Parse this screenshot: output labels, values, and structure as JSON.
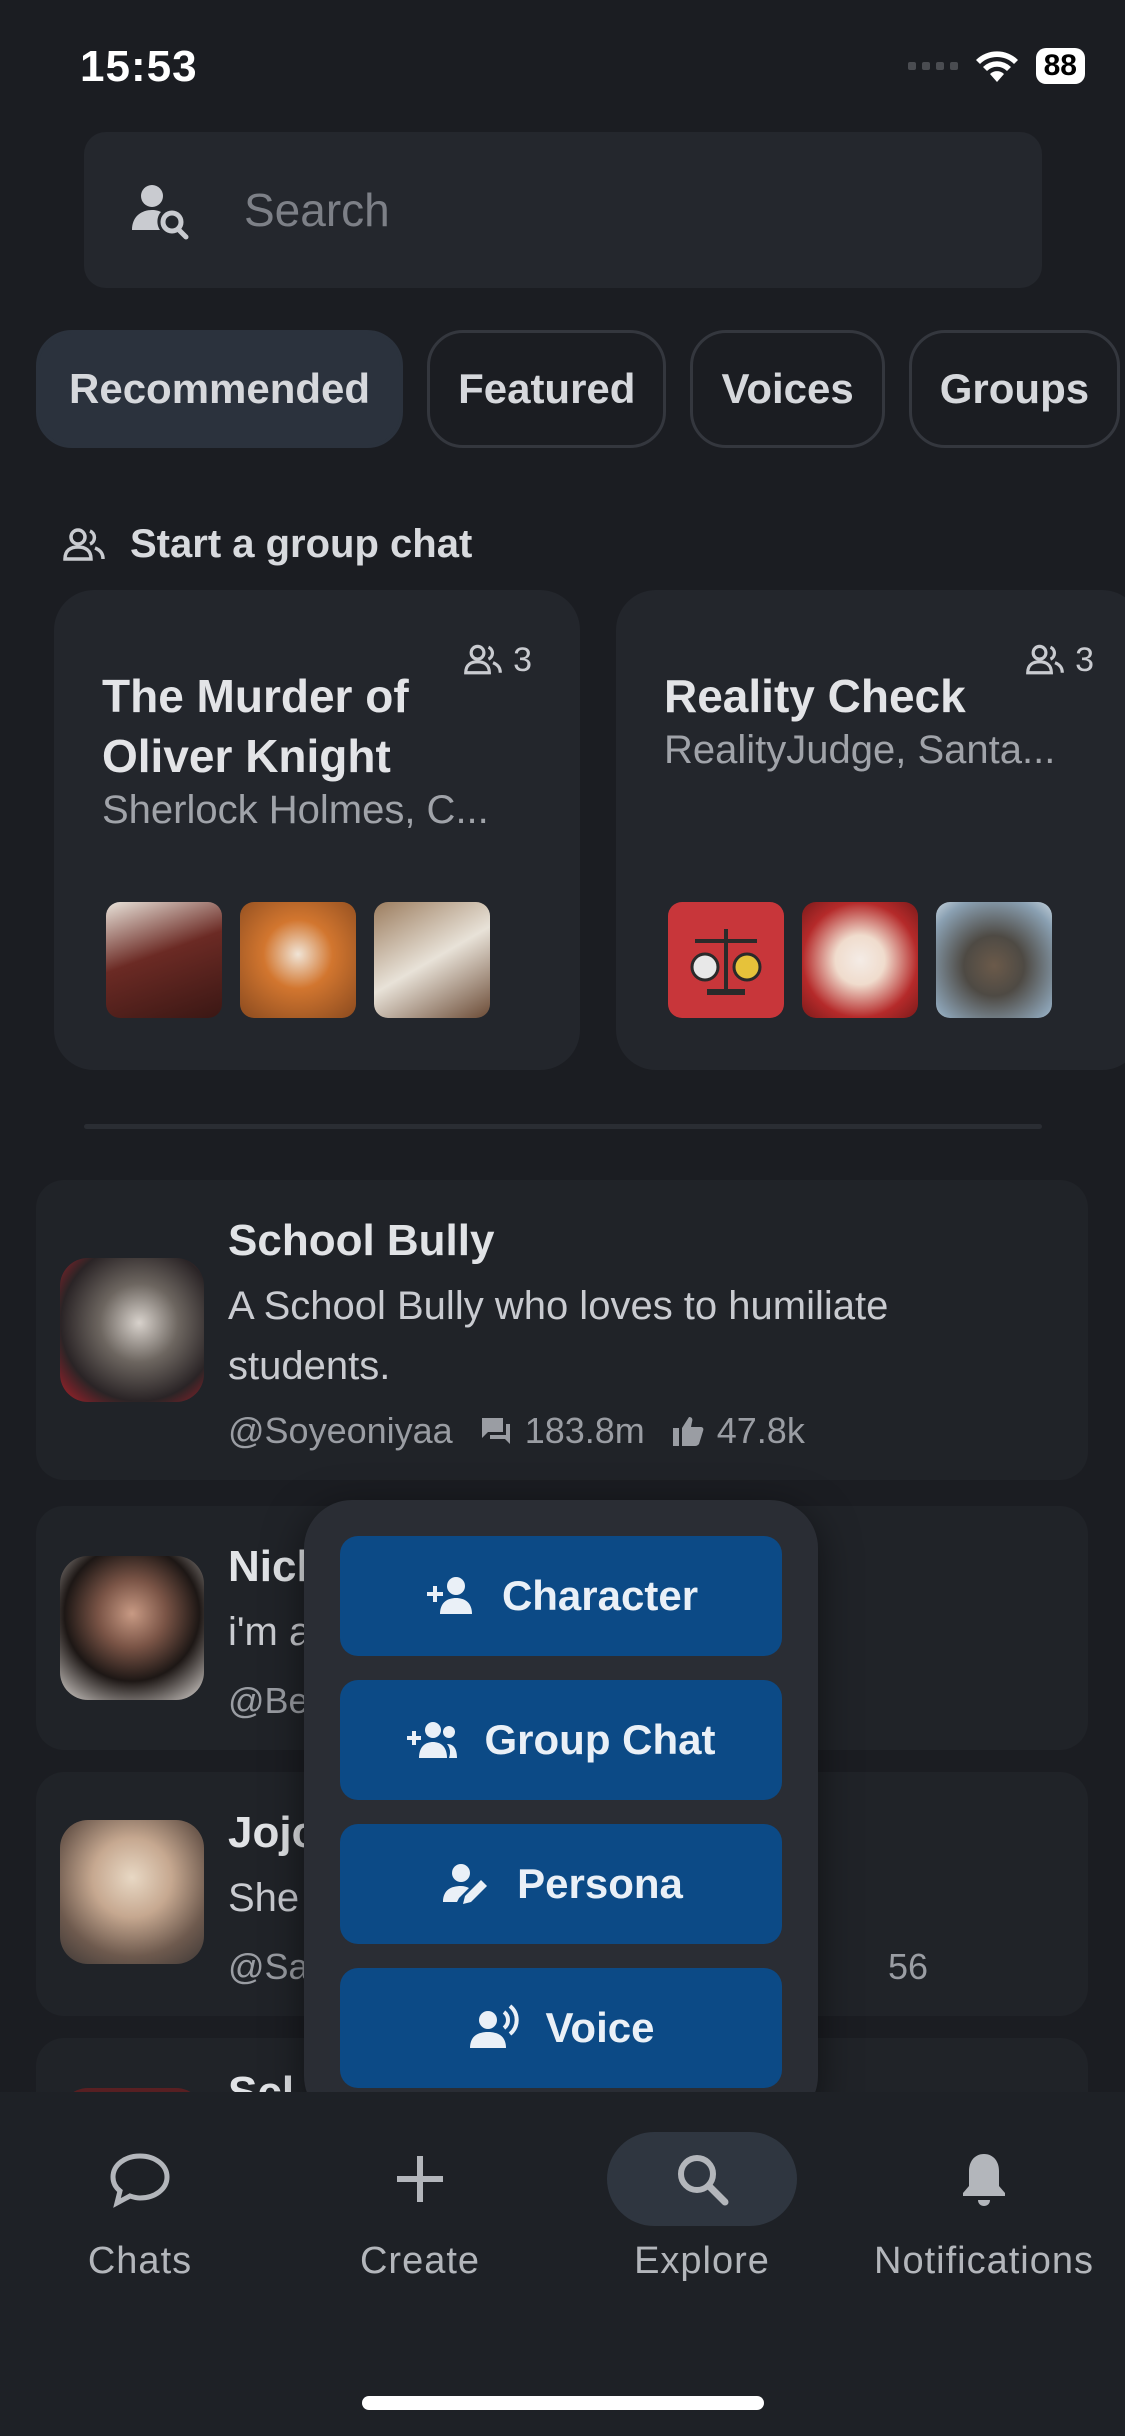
{
  "status": {
    "time": "15:53",
    "battery": "88"
  },
  "search": {
    "placeholder": "Search"
  },
  "tabs": [
    {
      "label": "Recommended",
      "active": true
    },
    {
      "label": "Featured"
    },
    {
      "label": "Voices"
    },
    {
      "label": "Groups"
    }
  ],
  "group_section": {
    "title": "Start a group chat",
    "cards": [
      {
        "title": "The Murder of Oliver Knight",
        "members": "Sherlock Holmes, C...",
        "count": "3",
        "avatar_colors": [
          "#5a2a26",
          "#c9642a",
          "#8a6d52"
        ]
      },
      {
        "title": "Reality Check",
        "members": "RealityJudge, Santa...",
        "count": "3",
        "avatar_colors": [
          "#c8363a",
          "#b52a2a",
          "#5e6d7a"
        ]
      }
    ]
  },
  "characters": [
    {
      "name": "School Bully",
      "description": "A School Bully who loves to humiliate students.",
      "handle": "@Soyeoniyaa",
      "chats": "183.8m",
      "likes": "47.8k"
    },
    {
      "name": "Nicl",
      "description": "i'm a",
      "handle": "@Bes"
    },
    {
      "name": "Jojo",
      "description": "She",
      "handle": "@Sar",
      "extra": "56"
    },
    {
      "name": "Scl"
    }
  ],
  "create_menu": {
    "items": [
      {
        "label": "Character",
        "icon": "add-person-icon"
      },
      {
        "label": "Group Chat",
        "icon": "add-group-icon"
      },
      {
        "label": "Persona",
        "icon": "persona-edit-icon"
      },
      {
        "label": "Voice",
        "icon": "voice-icon"
      }
    ]
  },
  "nav": {
    "items": [
      {
        "label": "Chats",
        "icon": "chat-bubble-icon"
      },
      {
        "label": "Create",
        "icon": "plus-icon"
      },
      {
        "label": "Explore",
        "icon": "search-icon",
        "active": true
      },
      {
        "label": "Notifications",
        "icon": "bell-icon"
      }
    ]
  },
  "colors": {
    "accent_button": "#0c4a86",
    "background": "#1b1d22",
    "card": "#23262c"
  }
}
